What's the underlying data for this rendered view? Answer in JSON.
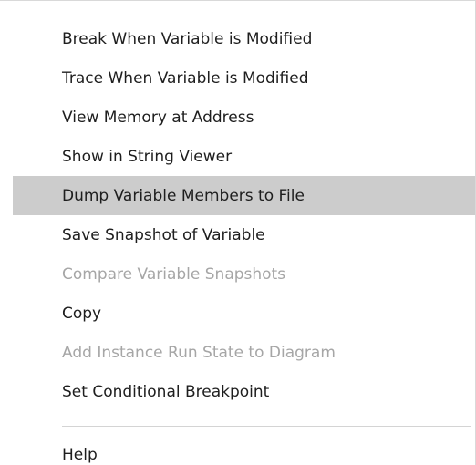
{
  "context_menu": {
    "items": [
      {
        "label": "Break When Variable is Modified",
        "enabled": true,
        "highlighted": false
      },
      {
        "label": "Trace When Variable is Modified",
        "enabled": true,
        "highlighted": false
      },
      {
        "label": "View Memory at Address",
        "enabled": true,
        "highlighted": false
      },
      {
        "label": "Show in String Viewer",
        "enabled": true,
        "highlighted": false
      },
      {
        "label": "Dump Variable Members to File",
        "enabled": true,
        "highlighted": true
      },
      {
        "label": "Save Snapshot of Variable",
        "enabled": true,
        "highlighted": false
      },
      {
        "label": "Compare Variable Snapshots",
        "enabled": false,
        "highlighted": false
      },
      {
        "label": "Copy",
        "enabled": true,
        "highlighted": false
      },
      {
        "label": "Add Instance Run State to Diagram",
        "enabled": false,
        "highlighted": false
      },
      {
        "label": "Set Conditional Breakpoint",
        "enabled": true,
        "highlighted": false
      }
    ],
    "help_label": "Help"
  },
  "colors": {
    "text": "#1e1e1e",
    "disabled_text": "#a6a6a6",
    "highlight_background": "#cccccc",
    "separator": "#d4d4d4",
    "background": "#ffffff"
  }
}
